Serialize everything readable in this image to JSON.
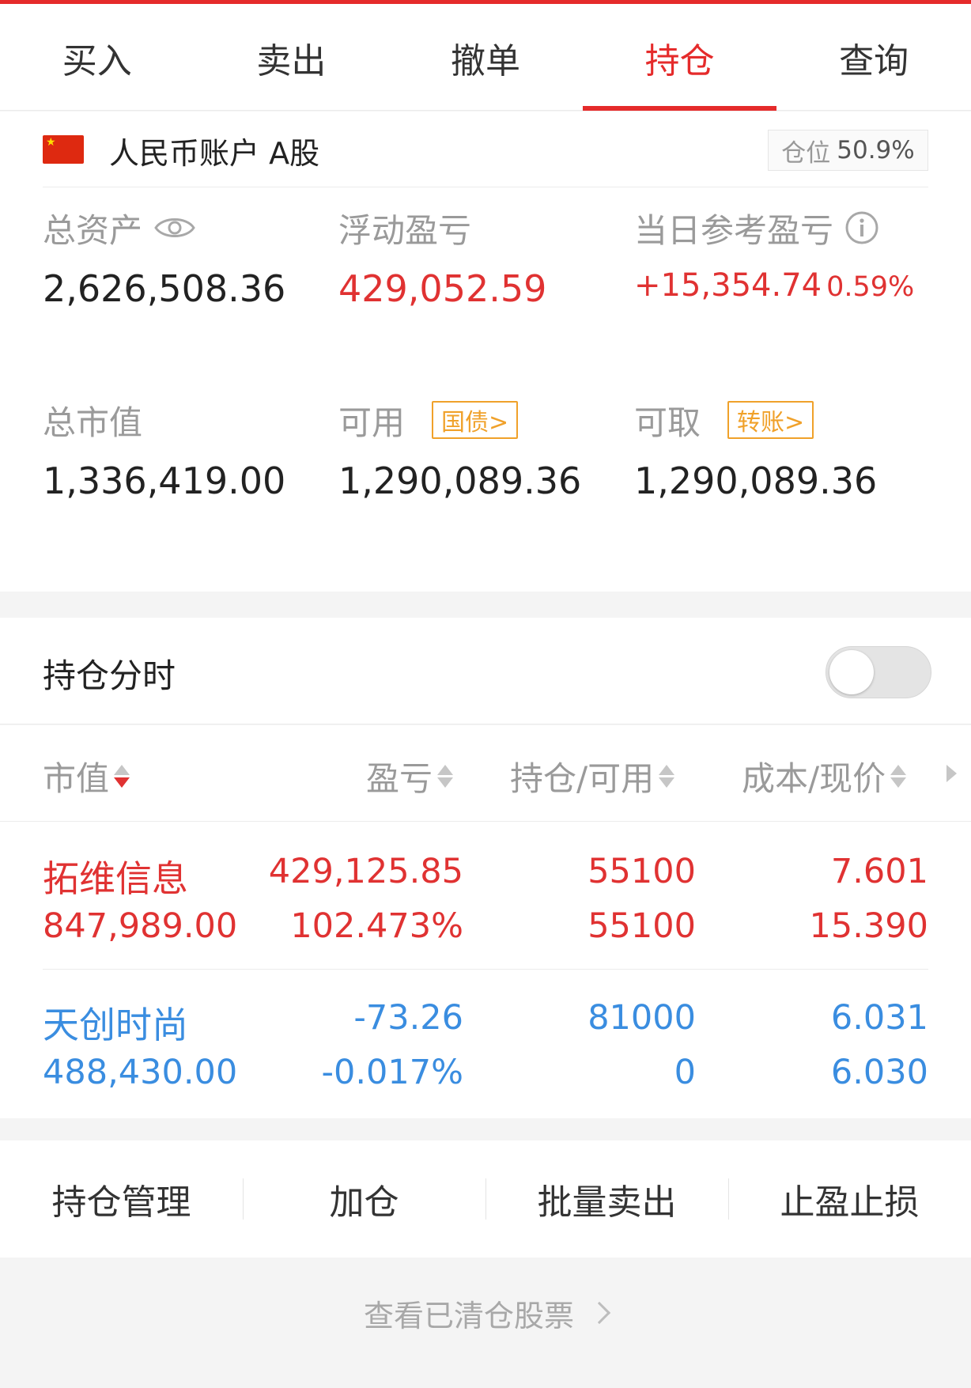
{
  "tabs": [
    "买入",
    "卖出",
    "撤单",
    "持仓",
    "查询"
  ],
  "account": {
    "name": "人民币账户 A股",
    "position_label": "仓位",
    "position_value": "50.9%"
  },
  "summary": {
    "total_assets": {
      "label": "总资产",
      "value": "2,626,508.36"
    },
    "floating_pl": {
      "label": "浮动盈亏",
      "value": "429,052.59"
    },
    "daily_pl": {
      "label": "当日参考盈亏",
      "value": "+15,354.74",
      "pct": "0.59%"
    },
    "market_value": {
      "label": "总市值",
      "value": "1,336,419.00"
    },
    "available": {
      "label": "可用",
      "tag": "国债>",
      "value": "1,290,089.36"
    },
    "withdrawable": {
      "label": "可取",
      "tag": "转账>",
      "value": "1,290,089.36"
    }
  },
  "timeshare": {
    "label": "持仓分时",
    "enabled": false
  },
  "columns": [
    "市值",
    "盈亏",
    "持仓/可用",
    "成本/现价"
  ],
  "holdings": [
    {
      "name": "拓维信息",
      "market_value": "847,989.00",
      "pl": "429,125.85",
      "pl_pct": "102.473%",
      "position": "55100",
      "available": "55100",
      "cost": "7.601",
      "price": "15.390",
      "direction": "up"
    },
    {
      "name": "天创时尚",
      "market_value": "488,430.00",
      "pl": "-73.26",
      "pl_pct": "-0.017%",
      "position": "81000",
      "available": "0",
      "cost": "6.031",
      "price": "6.030",
      "direction": "down"
    }
  ],
  "actions": [
    "持仓管理",
    "加仓",
    "批量卖出",
    "止盈止损"
  ],
  "cleared_link": "查看已清仓股票",
  "colors": {
    "accent": "#e52b2b",
    "gain": "#e03232",
    "loss": "#3a8de0",
    "tag": "#f0a12a"
  }
}
